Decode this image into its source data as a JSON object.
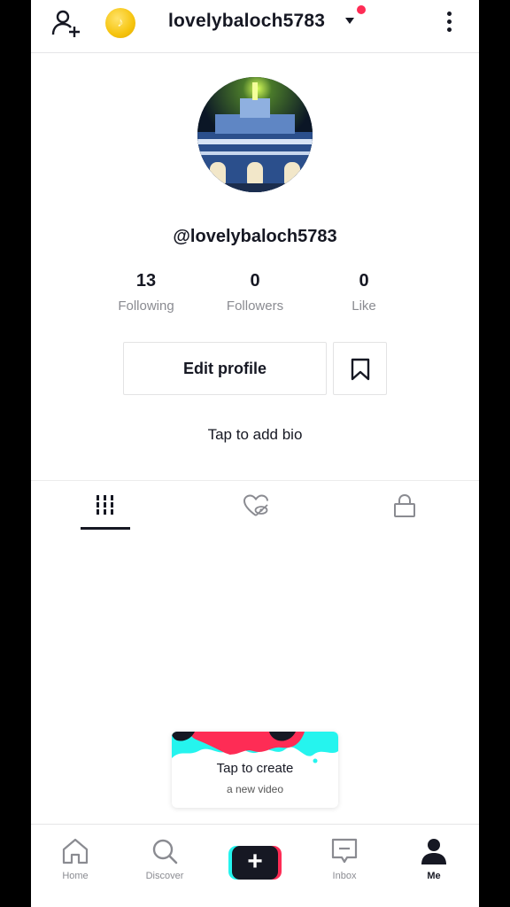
{
  "header": {
    "username": "lovelybaloch5783",
    "coin_glyph": "♪"
  },
  "profile": {
    "handle": "@lovelybaloch5783",
    "bio_placeholder": "Tap to add bio",
    "edit_label": "Edit profile"
  },
  "stats": [
    {
      "value": "13",
      "label": "Following"
    },
    {
      "value": "0",
      "label": "Followers"
    },
    {
      "value": "0",
      "label": "Like"
    }
  ],
  "tabs": [
    "videos-grid-icon",
    "liked-hidden-icon",
    "private-lock-icon"
  ],
  "create_card": {
    "title": "Tap to create",
    "subtitle": "a new video"
  },
  "bottom_nav": {
    "home": "Home",
    "discover": "Discover",
    "create": "+",
    "inbox": "Inbox",
    "me": "Me"
  },
  "colors": {
    "accent_red": "#fe2c55",
    "accent_cyan": "#25f4ee",
    "text": "#161823",
    "muted": "#8a8b91"
  }
}
